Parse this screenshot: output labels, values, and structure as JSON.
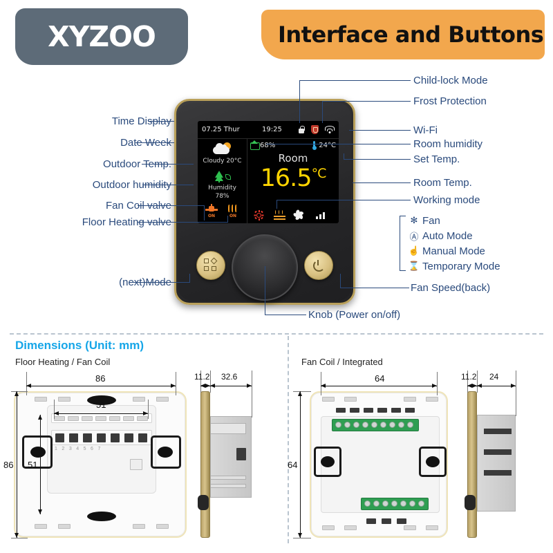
{
  "header": {
    "logo_text": "XYZOO",
    "banner_title": "Interface and Buttons"
  },
  "device": {
    "screen": {
      "status_bar": {
        "date": "07.25 Thur",
        "time": "19:25",
        "icons": [
          "lock-icon",
          "shield-icon",
          "wifi-icon"
        ]
      },
      "left_panel": {
        "weather_icon": "cloudy-sun-icon",
        "weather_text": "Cloudy 20°C",
        "humidity_icon": "tree-icon",
        "humidity_label": "Humidity",
        "humidity_value": "78%",
        "valve_state": "ON",
        "floor_heating_state": "ON"
      },
      "right_panel": {
        "room_humidity": "68%",
        "set_temp": "24°C",
        "room_label": "Room",
        "room_temp": "16.5",
        "room_temp_unit": "°C",
        "mode_icons": [
          "sun-icon",
          "floor-heating-icon",
          "fan-icon",
          "signal-bars-icon"
        ]
      }
    },
    "buttons": {
      "left_icon": "mode-grid-icon",
      "right_icon": "fan-speed-icon",
      "knob": "rotary-knob"
    }
  },
  "callouts": {
    "left": [
      "Time Display",
      "Date Week",
      "Outdoor Temp.",
      "Outdoor humidity",
      "Fan  Coil valve",
      "Floor Heating valve"
    ],
    "right": [
      "Child-lock Mode",
      "Frost Protection",
      "Wi-Fi",
      "Room humidity",
      "Set Temp.",
      "Room Temp.",
      "Working mode"
    ],
    "bottom_left": "(next)Mode",
    "bottom_center": "Knob  (Power on/off)",
    "bottom_right": "Fan Speed(back)"
  },
  "modes": [
    {
      "icon": "fan-glyph",
      "glyph": "✻",
      "label": "Fan"
    },
    {
      "icon": "auto-glyph",
      "glyph": "Ⓐ",
      "label": "Auto  Mode"
    },
    {
      "icon": "manual-glyph",
      "glyph": "☝",
      "label": "Manual  Mode"
    },
    {
      "icon": "temporary-glyph",
      "glyph": "⌛",
      "label": "Temporary Mode"
    }
  ],
  "dimensions": {
    "title": "Dimensions (Unit: mm)",
    "left_subtitle": "Floor Heating / Fan Coil",
    "right_subtitle": "Fan Coil / Integrated",
    "left_front_width": "86",
    "left_front_height": "86",
    "left_inner_width": "51",
    "left_inner_height": "51",
    "left_side_front_depth": "11.2",
    "left_side_body_depth": "32.6",
    "right_front_width": "64",
    "right_front_height": "64",
    "right_side_front_depth": "11.2",
    "right_side_body_depth": "24",
    "terminal_numbers": [
      "1",
      "2",
      "3",
      "4",
      "5",
      "6",
      "7"
    ]
  },
  "colors": {
    "banner": "#F2A74D",
    "logo_bg": "#5D6B78",
    "callout": "#2A4A7C",
    "dim_title": "#16A6E8",
    "temp_yellow": "#FFD400",
    "gold": "#D8C48C"
  }
}
